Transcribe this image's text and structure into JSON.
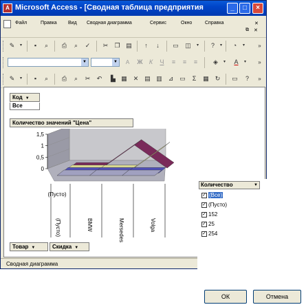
{
  "window": {
    "title": "Microsoft Access - [Сводная таблица предприятия"
  },
  "menu": {
    "items": [
      "Файл",
      "Правка",
      "Вид",
      "Сводная диаграмма",
      "Сервис",
      "Окно",
      "Справка"
    ]
  },
  "format_toolbar": {
    "bold": "Ж",
    "italic": "К",
    "underline": "Ч",
    "font_color": "A"
  },
  "pivot": {
    "filter_field": "Код",
    "filter_value": "Все",
    "data_field": "Количество значений \"Цена\"",
    "category_fields": [
      "Товар",
      "Скидка"
    ],
    "series_field": "Количество"
  },
  "chart_data": {
    "type": "bar",
    "ylim": [
      0,
      1.5
    ],
    "yticks": [
      "1,5",
      "1",
      "0,5",
      "0"
    ],
    "categories": [
      "(Пусто)",
      "BMW",
      "Mersedes",
      "Volga"
    ],
    "top_category": "(Пусто)",
    "series": [
      {
        "values": [
          0,
          0,
          1,
          0
        ],
        "color": "#7a2a5a"
      },
      {
        "values": [
          0,
          0,
          0,
          1
        ],
        "color": "#d8d890"
      },
      {
        "values": [
          0,
          0,
          0,
          0
        ],
        "color": "#5050b8"
      },
      {
        "values": [
          0,
          0,
          0,
          0
        ],
        "color": "#a0a0c0"
      }
    ]
  },
  "legend": {
    "items": [
      {
        "label": "(Все)",
        "checked": true,
        "selected": true
      },
      {
        "label": "(Пусто)",
        "checked": true
      },
      {
        "label": "152",
        "checked": true
      },
      {
        "label": "25",
        "checked": true
      },
      {
        "label": "254",
        "checked": true
      }
    ]
  },
  "status": {
    "text": "Сводная диаграмма"
  },
  "dialog": {
    "ok_label": "ОК",
    "cancel_label": "Отмена"
  }
}
